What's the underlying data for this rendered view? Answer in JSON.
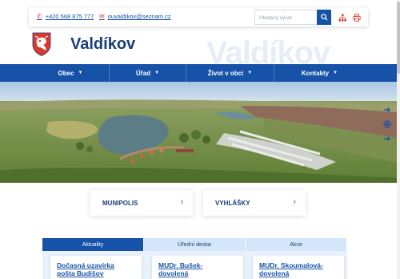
{
  "header": {
    "phone": "+420 568 875 777",
    "email": "ouvaldikov@seznam.cz",
    "search_placeholder": "Hledaný výraz",
    "title": "Valdíkov",
    "watermark": "Valdíkov"
  },
  "nav": {
    "items": [
      {
        "label": "Obec"
      },
      {
        "label": "Úřad"
      },
      {
        "label": "Život v obci"
      },
      {
        "label": "Kontakty"
      }
    ]
  },
  "quick_links": [
    {
      "label": "MUNIPOLIS"
    },
    {
      "label": "VYHLÁŠKY"
    }
  ],
  "tabs": [
    {
      "label": "Aktuality",
      "active": true
    },
    {
      "label": "Úřední deska",
      "active": false
    },
    {
      "label": "Akce",
      "active": false
    }
  ],
  "news": [
    {
      "title_line1": "Dočasná uzavírka",
      "title_line2": "pošta Budišov"
    },
    {
      "title_line1": "MUDr. Bušek-",
      "title_line2": "dovolená"
    },
    {
      "title_line1": "MUDr. Skoumalová-",
      "title_line2": "dovolená"
    }
  ],
  "colors": {
    "primary": "#1552a8",
    "accent": "#d83a2e",
    "tab_inactive": "#d4e6fa",
    "title": "#1a3e78"
  },
  "icons": {
    "phone": "phone-icon",
    "email": "envelope-icon",
    "search": "search-icon",
    "sitemap": "sitemap-icon",
    "print": "printer-icon",
    "share": "share-icon",
    "contrast": "contrast-icon",
    "arrow": "chevron-right-icon"
  }
}
